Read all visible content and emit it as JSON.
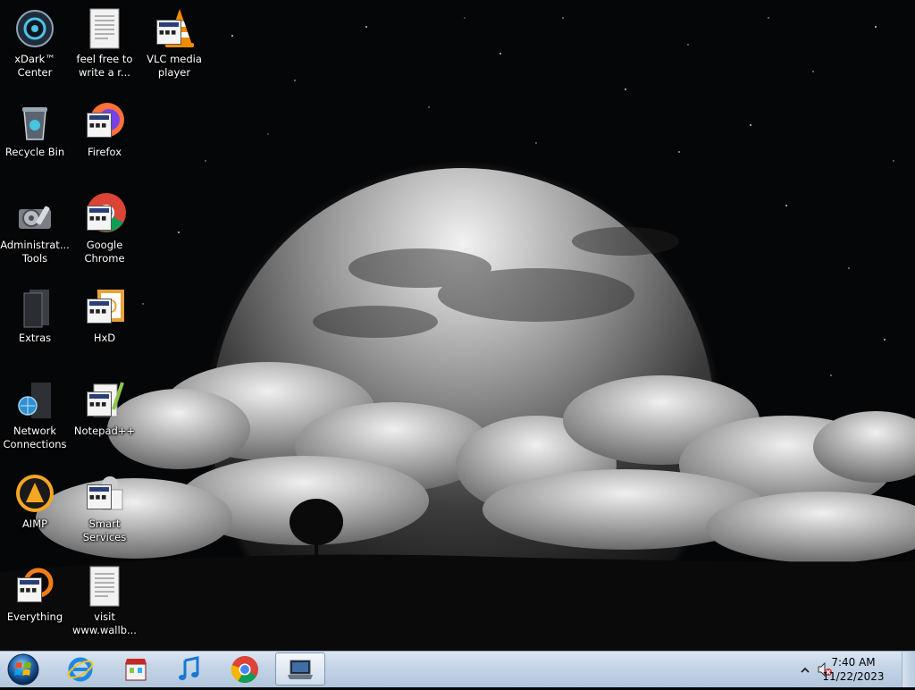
{
  "desktop": {
    "icons": [
      {
        "label": "xDark™ Center",
        "icon": "xdark-center-icon"
      },
      {
        "label": "feel free to write a r...",
        "icon": "text-document-icon"
      },
      {
        "label": "VLC media player",
        "icon": "vlc-icon"
      },
      {
        "label": "Recycle Bin",
        "icon": "recycle-bin-icon"
      },
      {
        "label": "Firefox",
        "icon": "firefox-icon"
      },
      {
        "label": "Administrat... Tools",
        "icon": "administrative-tools-icon"
      },
      {
        "label": "Google Chrome",
        "icon": "chrome-icon"
      },
      {
        "label": "Extras",
        "icon": "folder-icon"
      },
      {
        "label": "HxD",
        "icon": "hxd-icon"
      },
      {
        "label": "Network Connections",
        "icon": "network-connections-icon"
      },
      {
        "label": "Notepad++",
        "icon": "notepad-plus-plus-icon"
      },
      {
        "label": "AIMP",
        "icon": "aimp-icon"
      },
      {
        "label": "Smart Services",
        "icon": "smart-services-icon"
      },
      {
        "label": "Everything",
        "icon": "everything-search-icon"
      },
      {
        "label": "visit www.wallb...",
        "icon": "text-document-icon"
      }
    ]
  },
  "taskbar": {
    "start_icon": "windows-orb-icon",
    "pinned": [
      {
        "name": "internet-explorer",
        "icon": "internet-explorer-icon"
      },
      {
        "name": "store",
        "icon": "store-icon"
      },
      {
        "name": "music",
        "icon": "music-note-icon"
      },
      {
        "name": "chrome",
        "icon": "chrome-icon"
      },
      {
        "name": "remote-desktop",
        "icon": "laptop-icon",
        "active": true
      }
    ],
    "tray": {
      "show_hidden_icon": "chevron-up-icon",
      "volume_icon": "volume-muted-icon",
      "time": "7:40 AM",
      "date": "11/22/2023"
    }
  },
  "colors": {
    "taskbar_top": "#dbe6f2",
    "taskbar_bottom": "#b2c6dc",
    "desktop_bg": "#050608"
  }
}
